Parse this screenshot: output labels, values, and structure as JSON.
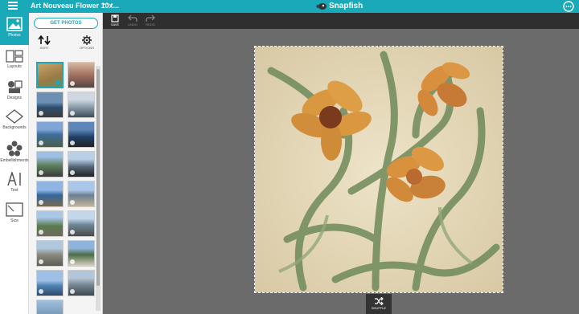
{
  "topbar": {
    "title": "Art Nouveau Flower 10x...",
    "more": "···",
    "logo": "Snapfish"
  },
  "rail": {
    "photos": "Photos",
    "layouts": "Layouts",
    "designs": "Designs",
    "backgrounds": "Backgrounds",
    "embellishments": "Embellishments",
    "text": "Text",
    "size": "Size"
  },
  "panel": {
    "get_photos": "GET PHOTOS",
    "sort": "SORT",
    "options": "OPTIONS"
  },
  "toolbar": {
    "save": "SAVE",
    "undo": "UNDO",
    "redo": "REDO"
  },
  "shuffle": "SHUFFLE",
  "colors": {
    "accent": "#1aa9b8",
    "workspace": "#6b6b6b",
    "toolbar": "#2f2f2f"
  }
}
